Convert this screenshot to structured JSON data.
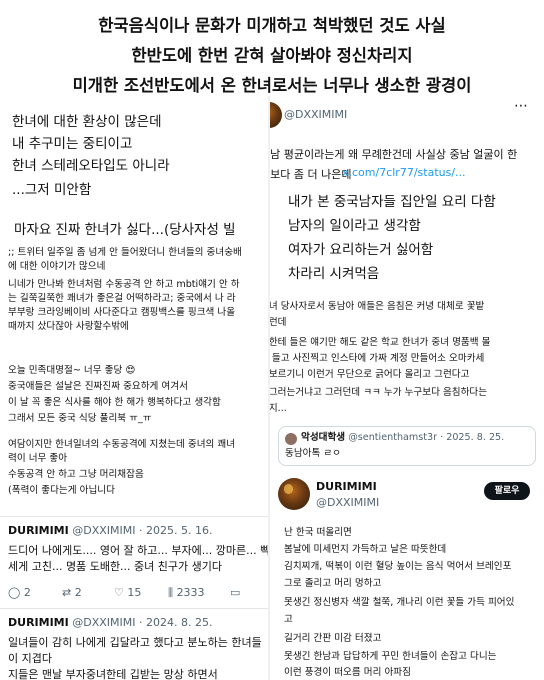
{
  "captions": [
    "한국음식이나 문화가 미개하고 척박했던 것도 사실",
    "한반도에 한번 갇혀 살아봐야 정신차리지",
    "미개한 조선반도에서 온 한녀로서는 너무나 생소한 광경이"
  ],
  "left_top": {
    "lines": [
      "한녀에 대한 환상이 많은데",
      "내 추구미는 중티이고",
      "한녀 스테레오타입도 아니라",
      "...그저 미안함"
    ],
    "headline": "마자요 진짜 한녀가 싫다...(당사자성 빌"
  },
  "left_post": {
    "paragraph1": [
      ";; 트위터 일주일 좀 넘게 안 들어왔더니 한녀들의 중녀숭배",
      "에 대한 이야기가 많으네",
      "니네가 만나봐 한녀처럼 수동공격 안 하고 mbti얘기 안 하",
      "는 길쭉길쭉한 쾌녀가 좋은걸 어떡하라고; 중국에서 나 라",
      "부부랑 크라잉베이비 사다준다고 캠핑백스를 핑크색 나올",
      "때까지 샀다잖아 사랑할수밖에"
    ],
    "paragraph2": [
      "오늘 민족대명절~ 너무 좋당 😍",
      "중국애들은 설날은 진짜진짜 중요하게 여겨서",
      "이 날 꼭 좋은 식사를 해야 한 해가 행복하다고 생각함",
      "그래서 모든 중국 식당 풀리북 ㅠ_ㅠ"
    ],
    "paragraph3": [
      "여담이지만 한녀일녀의 수동공격에 지쳤는데 중녀의 쾌녀",
      "력이 너무 좋아",
      "수동공격 안 하고 그냥 머리채잡음",
      "(폭력이 좋다는게 아닙니다"
    ]
  },
  "tweet1": {
    "author": "DURIMIMI",
    "handle": "@DXXIMIMI",
    "date": "· 2025. 5. 16.",
    "lines": [
      "드디어 나에게도.... 영어 잘 하고... 부자에... 깡마른... 빡",
      "세게 고친... 명품 도배한... 중녀 친구가 생기다"
    ],
    "replies": "2",
    "retweets": "2",
    "likes": "15",
    "views": "2333"
  },
  "tweet2": {
    "author": "DURIMIMI",
    "handle": "@DXXIMIMI",
    "date": "· 2024. 8. 25.",
    "lines": [
      "일녀들이 감히 나에게 깁달라고 했다고 분노하는 한녀들",
      "이 지겹다",
      "지들은 맨날 부자중녀한테 깁받는 망상 하면서"
    ]
  },
  "right_top": {
    "handle": "@DXXIMIMI",
    "lines": [
      "중남 평균이라는게 왜 무례한건데 사실상 중남 얼굴이 한",
      "남보다 좀 더 나은데"
    ],
    "link": "x.com/7clr77/status/..."
  },
  "right_overlay": {
    "lines": [
      "내가 본 중국남자들 집안일 요리 다함",
      "남자의 일이라고 생각함",
      "여자가 요리하는거 싫어함",
      "차라리 시켜먹음"
    ]
  },
  "right_mid": {
    "lines": [
      "한녀 당사자로서 동남아 애들은 음침은 커녕 대체로 꽃밭",
      "캐런데",
      "애한테 들은 얘기만 해도 같은 학교 한녀가 중녀 명품백 몰",
      "래 들고 사진찍고 인스타에 가짜 계정 만들어소 오마카세",
      "람보르기니 이런거 무단으로 긁어다 올리고 그런다고",
      "왜그러는거냐고 그러던데 ㅋㅋ 누가 누구보다 음침하다는",
      "건지..."
    ]
  },
  "right_quote": {
    "name": "악성대학생",
    "handle": "@sentienthamst3r",
    "date": "· 2025. 8. 25.",
    "text": "동남아톡 ㄹㅇ"
  },
  "right_post": {
    "author": "DURIMIMI",
    "handle": "@DXXIMIMI",
    "follow": "팔로우",
    "lines": [
      "난 한국 떠올리면",
      "봄날에 미세먼지 가득하고 날은 따뜻한데",
      "김치찌개, 떡볶이 이런 혈당 높이는 음식 먹어서 브레인포",
      "그로 졸리고 머리 멍하고",
      "못생긴 정신병자 색깔 철쭉, 개나리 이런 꽃들 가득 피어있",
      "고",
      "길거리 간판 미감 터졌고",
      "못생긴 한남과 답답하게 꾸민 한녀들이 손잡고 다니는",
      "이런 풍경이 떠오름 머리 아파짐"
    ]
  }
}
